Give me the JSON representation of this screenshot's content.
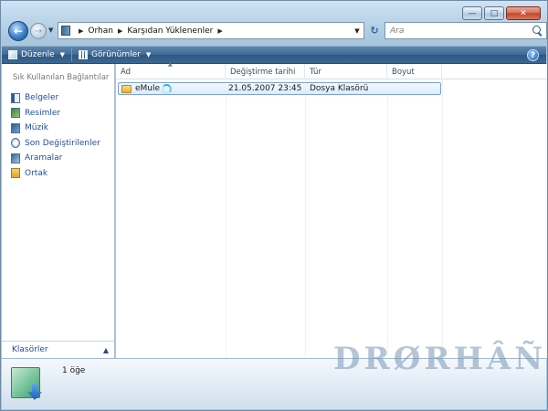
{
  "window": {
    "caption_buttons": {
      "minimize": "—",
      "maximize": "□",
      "close": "✕"
    }
  },
  "address_bar": {
    "crumbs": [
      "Orhan",
      "Karşıdan Yüklenenler"
    ],
    "search_placeholder": "Ara"
  },
  "toolbar": {
    "organize_label": "Düzenle",
    "views_label": "Görünümler",
    "help_label": "?"
  },
  "nav_pane": {
    "title": "Sık Kullanılan Bağlantılar",
    "items": [
      {
        "label": "Belgeler",
        "icon": "documents-icon"
      },
      {
        "label": "Resimler",
        "icon": "pictures-icon"
      },
      {
        "label": "Müzik",
        "icon": "music-icon"
      },
      {
        "label": "Son Değiştirilenler",
        "icon": "recent-icon"
      },
      {
        "label": "Aramalar",
        "icon": "searches-icon"
      },
      {
        "label": "Ortak",
        "icon": "public-folder-icon"
      }
    ],
    "folders_label": "Klasörler"
  },
  "file_list": {
    "columns": [
      "Ad",
      "Değiştirme tarihi",
      "Tür",
      "Boyut"
    ],
    "rows": [
      {
        "name": "eMule",
        "modified": "21.05.2007 23:45",
        "type": "Dosya Klasörü",
        "size": ""
      }
    ]
  },
  "details": {
    "item_count": "1 öğe"
  },
  "watermark": "DRØRHÂÑ",
  "colors": {
    "toolbar": "#3f6a94",
    "link": "#1f4d99",
    "selection": "#dcebfa"
  }
}
